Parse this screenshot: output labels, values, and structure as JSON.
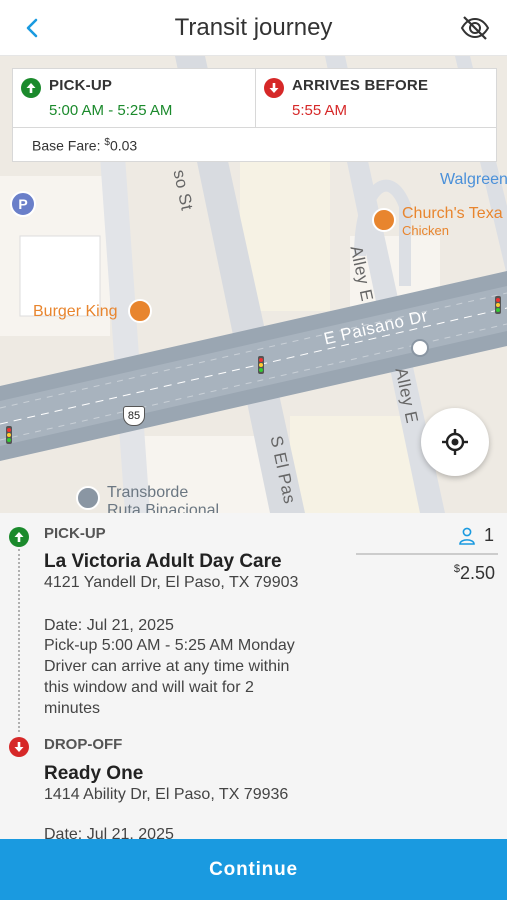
{
  "header": {
    "title": "Transit journey",
    "back_icon": "chevron-left-icon",
    "visibility_icon": "eye-off-icon"
  },
  "summary": {
    "pickup_label": "PICK-UP",
    "pickup_window": "5:00 AM - 5:25 AM",
    "arrives_label": "ARRIVES BEFORE",
    "arrives_time": "5:55 AM",
    "base_fare_label": "Base Fare:",
    "base_fare_currency": "$",
    "base_fare_value": "0.03"
  },
  "map": {
    "labels": {
      "walgreens": "Walgreen",
      "churchs": "Church's Texa",
      "churchs_sub": "Chicken",
      "burger_king": "Burger King",
      "paisano": "E Paisano Dr",
      "alley_e_1": "Alley E",
      "alley_e_2": "Alley E",
      "el_paso_st": "S El Pas",
      "so_st": "so St",
      "route": "85",
      "transborde": "Transborde",
      "ruta": "Ruta Binacional",
      "parking": "P"
    }
  },
  "trip": {
    "pickup": {
      "label": "PICK-UP",
      "place": "La Victoria Adult Day Care",
      "address": "4121 Yandell Dr, El Paso, TX 79903",
      "date": "Date: Jul 21, 2025",
      "window": "Pick-up 5:00 AM - 5:25 AM Monday",
      "note_1": "Driver can arrive at any time within",
      "note_2": "this window and will wait for 2",
      "note_3": "minutes"
    },
    "dropoff": {
      "label": "DROP-OFF",
      "place": "Ready One",
      "address": "1414 Ability Dr, El Paso, TX 79936",
      "date": "Date: Jul 21, 2025"
    },
    "passengers": "1",
    "price_currency": "$",
    "price_value": "2.50"
  },
  "actions": {
    "continue_label": "Continue"
  },
  "colors": {
    "accent": "#1a9ae0",
    "pickup_green": "#1b8a2c",
    "dropoff_red": "#d62828",
    "poi_orange": "#e8852e"
  }
}
